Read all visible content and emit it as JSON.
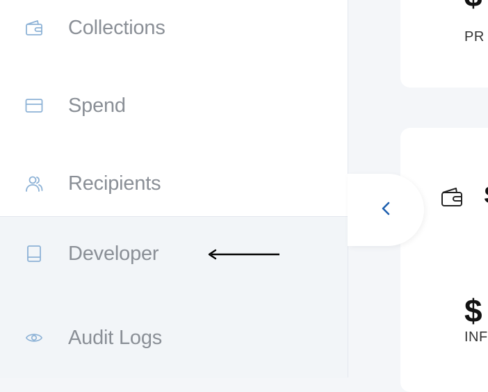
{
  "sidebar": {
    "items": [
      {
        "label": "Collections",
        "icon": "wallet-icon"
      },
      {
        "label": "Spend",
        "icon": "card-icon"
      },
      {
        "label": "Recipients",
        "icon": "users-icon"
      },
      {
        "label": "Developer",
        "icon": "book-icon"
      },
      {
        "label": "Audit Logs",
        "icon": "eye-icon"
      }
    ]
  },
  "main": {
    "card1": {
      "currency_symbol": "$",
      "caption": "PR"
    },
    "card2": {
      "title_initial": "S",
      "currency_symbol": "$",
      "caption": "INF"
    }
  },
  "colors": {
    "accent": "#1e5fae",
    "icon": "#8db2d6",
    "label": "#8a8f96"
  }
}
